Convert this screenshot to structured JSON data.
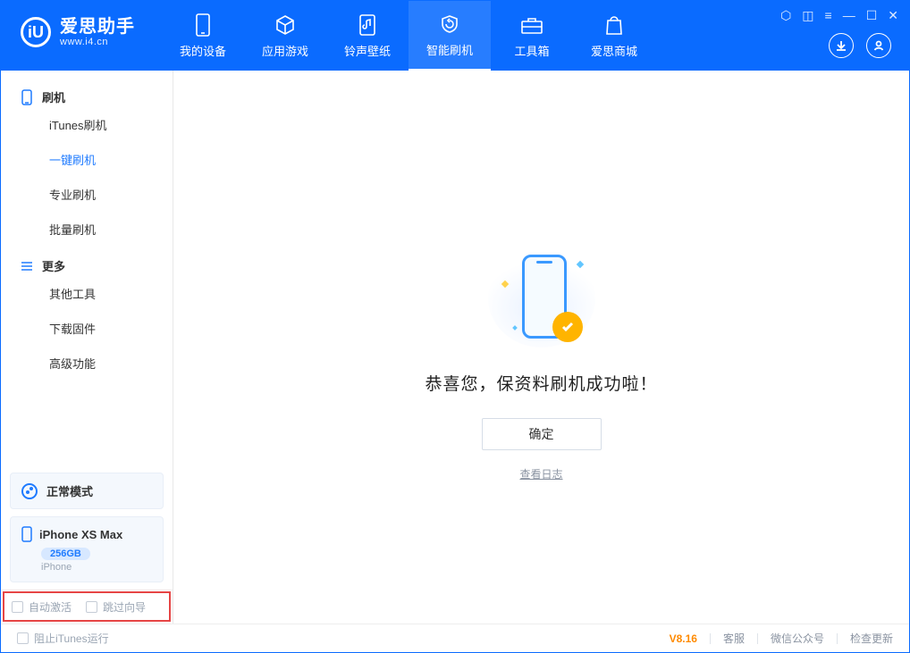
{
  "app": {
    "title": "爱思助手",
    "subtitle": "www.i4.cn"
  },
  "nav": {
    "items": [
      {
        "label": "我的设备"
      },
      {
        "label": "应用游戏"
      },
      {
        "label": "铃声壁纸"
      },
      {
        "label": "智能刷机"
      },
      {
        "label": "工具箱"
      },
      {
        "label": "爱思商城"
      }
    ],
    "active_index": 3
  },
  "sidebar": {
    "section_flash": "刷机",
    "flash_items": [
      "iTunes刷机",
      "一键刷机",
      "专业刷机",
      "批量刷机"
    ],
    "flash_active_index": 1,
    "section_more": "更多",
    "more_items": [
      "其他工具",
      "下载固件",
      "高级功能"
    ],
    "mode_label": "正常模式",
    "device": {
      "name": "iPhone XS Max",
      "capacity": "256GB",
      "type": "iPhone"
    },
    "bottom": {
      "auto_activate": "自动激活",
      "skip_guide": "跳过向导"
    }
  },
  "main": {
    "success_message": "恭喜您，保资料刷机成功啦！",
    "ok_button": "确定",
    "view_log": "查看日志"
  },
  "footer": {
    "block_itunes": "阻止iTunes运行",
    "version": "V8.16",
    "links": [
      "客服",
      "微信公众号",
      "检查更新"
    ]
  },
  "colors": {
    "accent": "#0a6bff",
    "accent_light": "#1f7bff",
    "warn": "#ffb400",
    "highlight_border": "#e64545"
  }
}
